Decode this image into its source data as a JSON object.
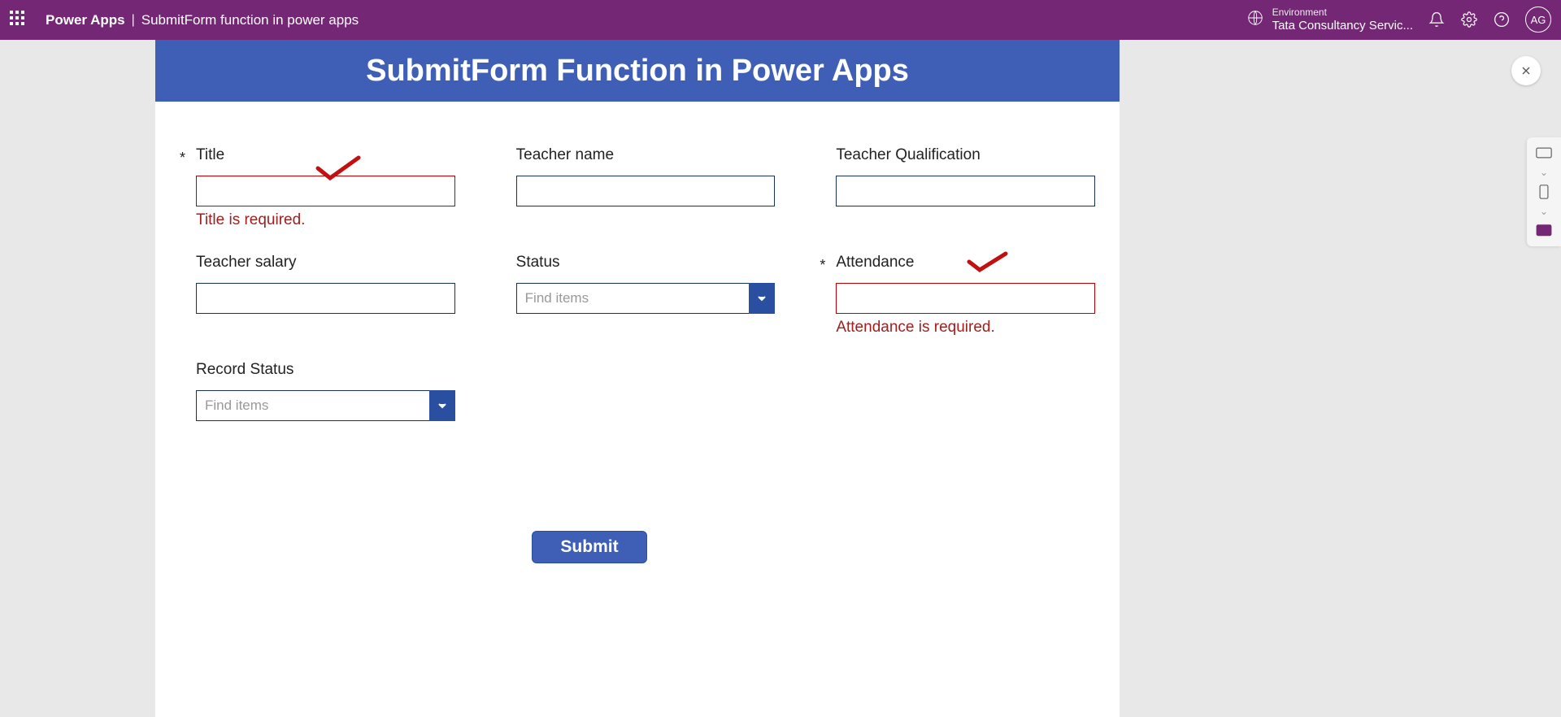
{
  "topbar": {
    "app_name": "Power Apps",
    "separator": "|",
    "page_title": "SubmitForm function in power apps",
    "env_label": "Environment",
    "env_name": "Tata Consultancy Servic...",
    "avatar_initials": "AG"
  },
  "form": {
    "header_title": "SubmitForm Function in Power Apps",
    "submit_label": "Submit",
    "fields": {
      "title": {
        "label": "Title",
        "required_star": "*",
        "error": "Title is required."
      },
      "teacher_name": {
        "label": "Teacher name"
      },
      "teacher_qualification": {
        "label": "Teacher Qualification"
      },
      "teacher_salary": {
        "label": "Teacher salary"
      },
      "status": {
        "label": "Status",
        "placeholder": "Find items"
      },
      "attendance": {
        "label": "Attendance",
        "required_star": "*",
        "error": "Attendance is required."
      },
      "record_status": {
        "label": "Record Status",
        "placeholder": "Find items"
      }
    }
  }
}
